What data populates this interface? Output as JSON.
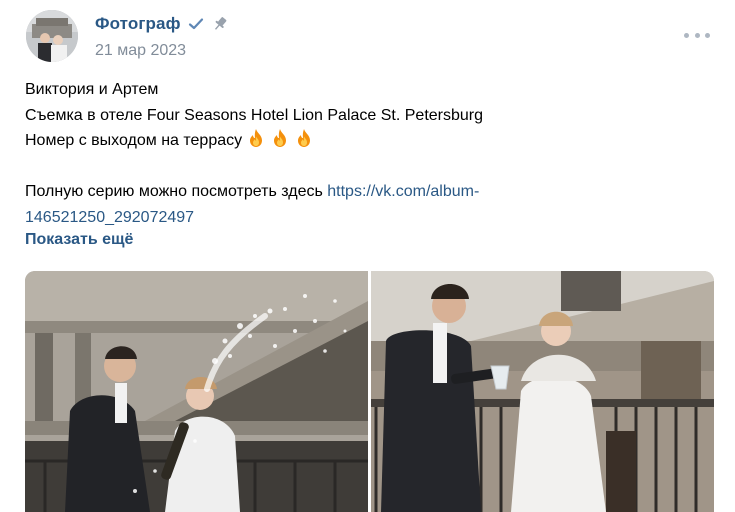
{
  "post": {
    "author": "Фотограф",
    "date": "21 мар 2023",
    "text_lines": [
      "Виктория и Артем",
      "Съемка в отеле Four Seasons Hotel Lion Palace St. Petersburg",
      "Номер с выходом на террасу"
    ],
    "series_text": "Полную серию можно посмотреть здесь ",
    "link_part1": "https://vk.com/album-",
    "link_part2": "146521250_292072497",
    "show_more": "Показать ещё"
  },
  "icons": {
    "verified": "verified-check-icon",
    "pin": "pin-icon",
    "more": "more-dots-icon",
    "fire": "fire-emoji"
  },
  "colors": {
    "link": "#2a5885",
    "date": "#818c99",
    "more_dots": "#aeb7c2"
  }
}
